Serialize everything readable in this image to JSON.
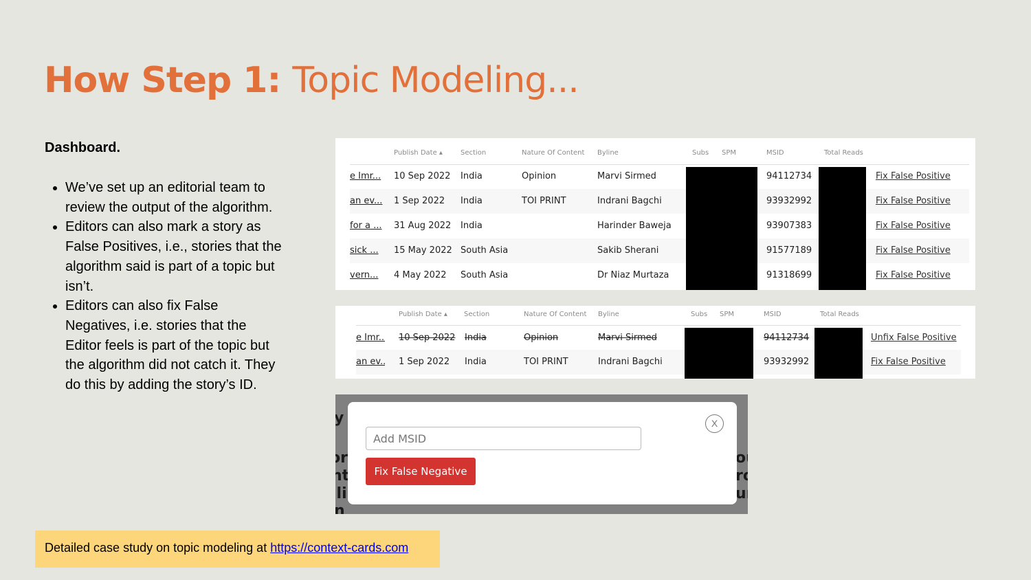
{
  "title": {
    "bold": "How Step 1:",
    "light": "Topic Modeling..."
  },
  "left": {
    "heading": "Dashboard.",
    "bullets": [
      "We’ve set up an editorial team to review the output of the algorithm.",
      "Editors can also mark a story as False Positives, i.e., stories that the algorithm said is part of a topic but isn’t.",
      "Editors can also fix False Negatives, i.e. stories that the Editor feels is part of the topic but the algorithm did not catch it. They do this by adding the story’s ID."
    ]
  },
  "table1": {
    "headers": {
      "publish_date": "Publish Date ▴",
      "section": "Section",
      "nature": "Nature Of Content",
      "byline": "Byline",
      "subs": "Subs",
      "spm": "SPM",
      "msid": "MSID",
      "total_reads": "Total Reads"
    },
    "rows": [
      {
        "title": "e Imr...",
        "date": "10 Sep 2022",
        "section": "India",
        "nature": "Opinion",
        "byline": "Marvi Sirmed",
        "msid": "94112734",
        "action": "Fix False Positive"
      },
      {
        "title": "an ev...",
        "date": "1 Sep 2022",
        "section": "India",
        "nature": "TOI PRINT",
        "byline": "Indrani Bagchi",
        "msid": "93932992",
        "action": "Fix False Positive"
      },
      {
        "title": "for a ...",
        "date": "31 Aug 2022",
        "section": "India",
        "nature": "",
        "byline": "Harinder Baweja",
        "msid": "93907383",
        "action": "Fix False Positive"
      },
      {
        "title": "sick ...",
        "date": "15 May 2022",
        "section": "South Asia",
        "nature": "",
        "byline": "Sakib Sherani",
        "msid": "91577189",
        "action": "Fix False Positive"
      },
      {
        "title": "vern...",
        "date": "4 May 2022",
        "section": "South Asia",
        "nature": "",
        "byline": "Dr Niaz Murtaza",
        "msid": "91318699",
        "action": "Fix False Positive"
      }
    ]
  },
  "table2": {
    "headers": {
      "publish_date": "Publish Date ▴",
      "section": "Section",
      "nature": "Nature Of Content",
      "byline": "Byline",
      "subs": "Subs",
      "spm": "SPM",
      "msid": "MSID",
      "total_reads": "Total Reads"
    },
    "rows": [
      {
        "title": "e Imr...",
        "date": "10 Sep 2022",
        "section": "India",
        "nature": "Opinion",
        "byline": "Marvi Sirmed",
        "msid": "94112734",
        "action": "Unfix False Positive",
        "struck": true
      },
      {
        "title": "an ev...",
        "date": "1 Sep 2022",
        "section": "India",
        "nature": "TOI PRINT",
        "byline": "Indrani Bagchi",
        "msid": "93932992",
        "action": "Fix False Positive",
        "struck": false
      }
    ]
  },
  "modal": {
    "input_placeholder": "Add MSID",
    "button_label": "Fix False Negative",
    "close_label": "X",
    "bg_fragments": [
      "y",
      "ori",
      "nt",
      "ili",
      "n",
      "ou",
      "ro",
      "ur"
    ]
  },
  "callout": {
    "text": "Detailed case study on topic modeling at ",
    "link": "https://context-cards.com"
  },
  "colors": {
    "accent": "#e2703a",
    "background": "#e6e6e1",
    "callout": "#fdd57a",
    "button_red": "#d43430"
  }
}
